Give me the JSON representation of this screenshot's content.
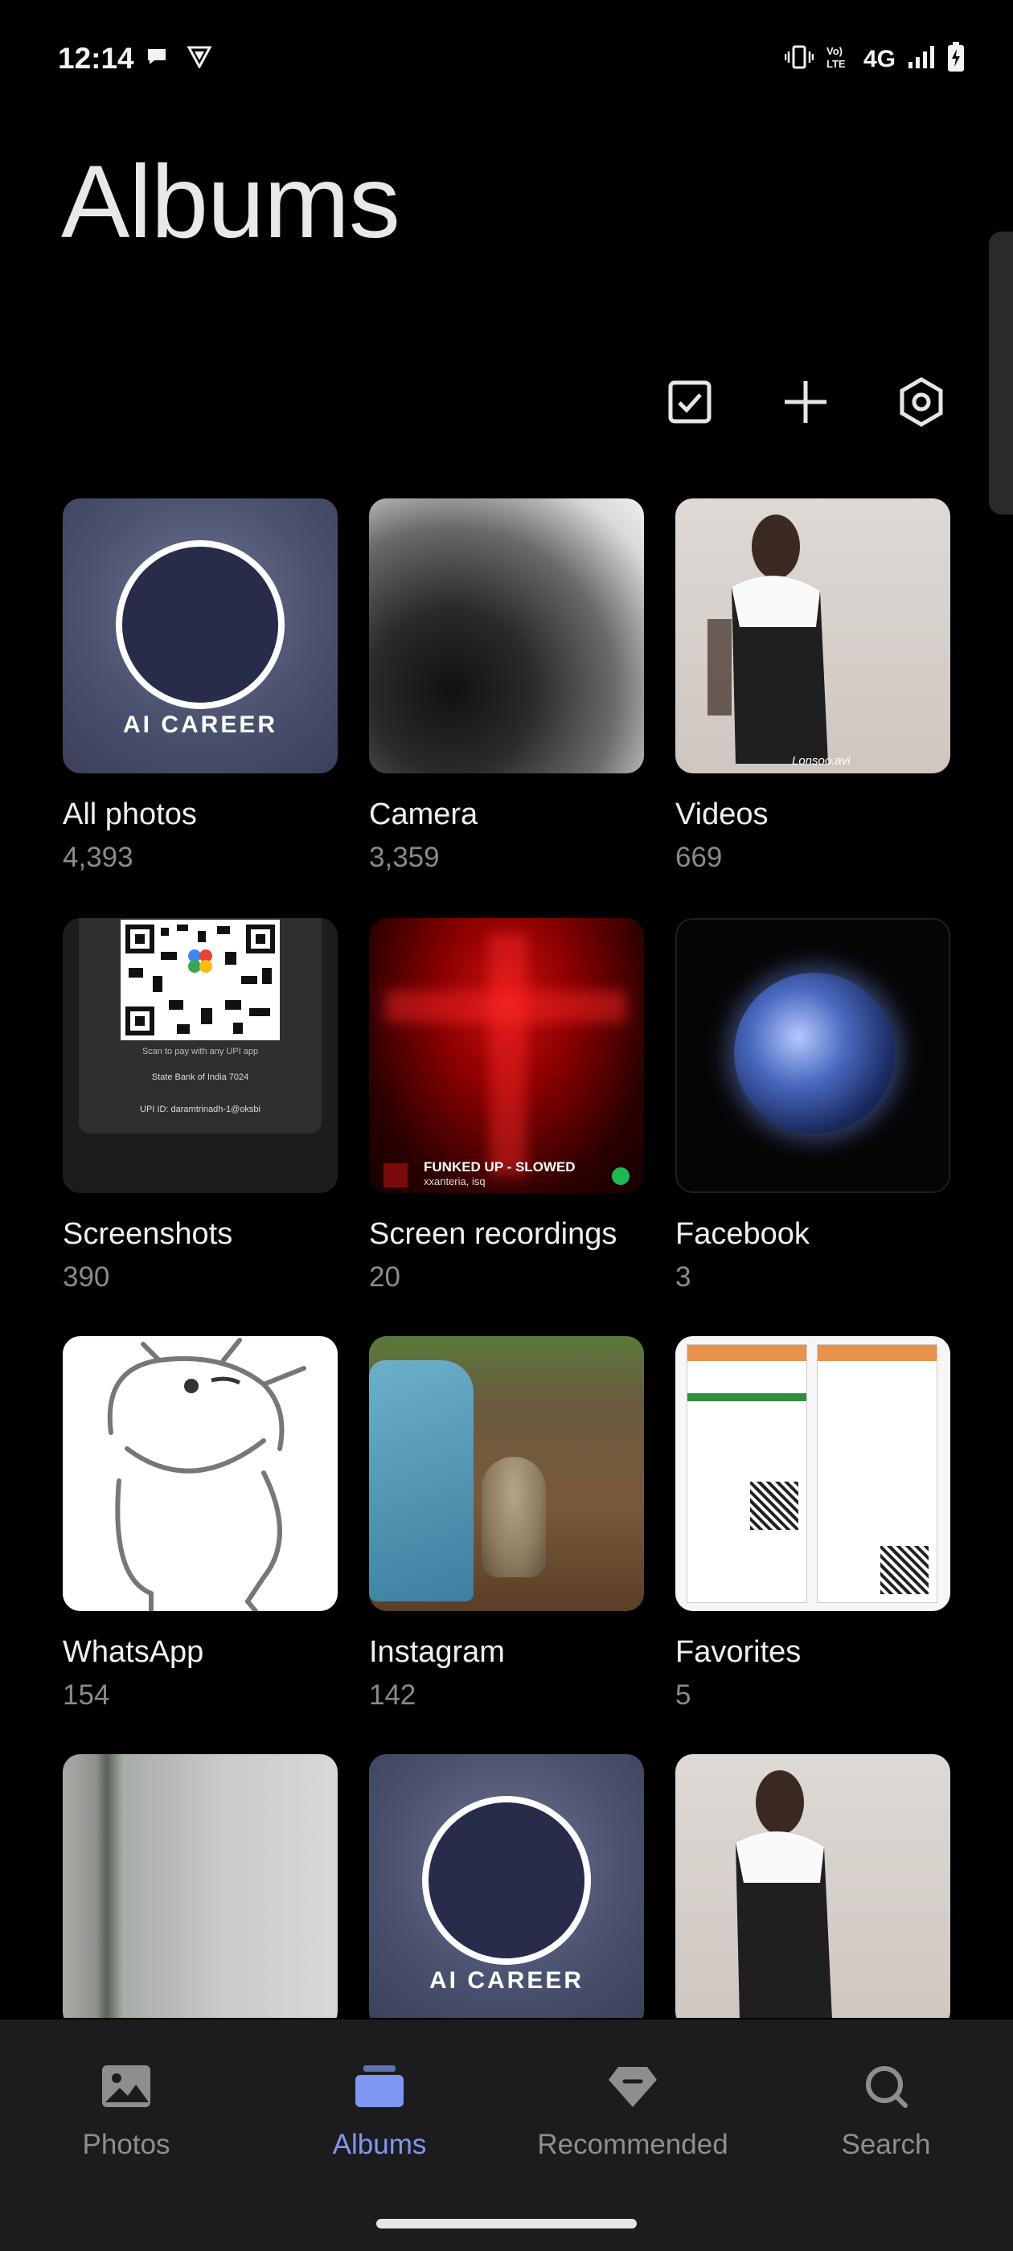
{
  "status_bar": {
    "time": "12:14",
    "network": "4G",
    "icons": [
      "chat-bubble-icon",
      "vpn-shield-icon",
      "vibrate-icon",
      "volte-icon",
      "signal-icon",
      "battery-charging-icon"
    ]
  },
  "header": {
    "title": "Albums"
  },
  "toolbar": {
    "actions": [
      "select-checkbox-icon",
      "add-icon",
      "settings-icon"
    ]
  },
  "albums": [
    {
      "name": "All photos",
      "count": "4,393",
      "thumb": "ai-career"
    },
    {
      "name": "Camera",
      "count": "3,359",
      "thumb": "blurred-animal"
    },
    {
      "name": "Videos",
      "count": "669",
      "thumb": "person-video"
    },
    {
      "name": "Screenshots",
      "count": "390",
      "thumb": "upi-qr"
    },
    {
      "name": "Screen recordings",
      "count": "20",
      "thumb": "red-cross"
    },
    {
      "name": "Facebook",
      "count": "3",
      "thumb": "globe"
    },
    {
      "name": "WhatsApp",
      "count": "154",
      "thumb": "sketch"
    },
    {
      "name": "Instagram",
      "count": "142",
      "thumb": "cat"
    },
    {
      "name": "Favorites",
      "count": "5",
      "thumb": "id-document"
    }
  ],
  "thumb_text": {
    "ai_career": "AI CAREER",
    "video_caption": "Lonsoo.avi",
    "qr_scan": "Scan to pay with any UPI app",
    "qr_bank": "State Bank of India 7024",
    "qr_upi": "UPI ID: daramtrinadh-1@oksbi",
    "rec_song": "FUNKED UP - SLOWED",
    "rec_artist": "xxanteria, isq"
  },
  "bottom_nav": {
    "items": [
      {
        "label": "Photos",
        "icon": "photo-icon",
        "active": false
      },
      {
        "label": "Albums",
        "icon": "albums-icon",
        "active": true
      },
      {
        "label": "Recommended",
        "icon": "diamond-icon",
        "active": false
      },
      {
        "label": "Search",
        "icon": "search-icon",
        "active": false
      }
    ]
  },
  "colors": {
    "background": "#000000",
    "accent": "#7f97f2",
    "nav_background": "#1c1c1e",
    "count_text": "#8a8a8a"
  }
}
